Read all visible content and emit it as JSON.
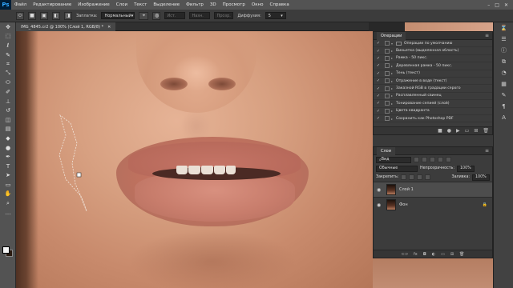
{
  "menubar": {
    "logo": "Ps",
    "items": [
      "Файл",
      "Редактирование",
      "Изображение",
      "Слои",
      "Текст",
      "Выделение",
      "Фильтр",
      "3D",
      "Просмотр",
      "Окно",
      "Справка"
    ],
    "minimize": "–",
    "maximize": "□",
    "close": "✕"
  },
  "options": {
    "mode_label": "Заплатка:",
    "mode_value": "Нормальный",
    "source_label": "Ист.",
    "dest_label": "Назн.",
    "transparent_label": "Прозр.",
    "diffusion_label": "Диффузия:",
    "diffusion_value": "5"
  },
  "document": {
    "tab_title": "IMG_4845.cr2 @ 100% (Слой 1, RGB/8) *",
    "close": "✕"
  },
  "history": {
    "tab": "Операции",
    "group": "Операции по умолчанию",
    "items": [
      "Виньетка (выделенная область)",
      "Рамка - 50 пикс.",
      "Деревянная рамка - 50 пикс.",
      "Тень (текст)",
      "Отражение в воде (текст)",
      "Заказной RGB в градации серого",
      "Расплавленный свинец",
      "Тонирование сепией (слой)",
      "Цвета квадранта",
      "Сохранить как Photoshop PDF"
    ]
  },
  "layers": {
    "tab": "Слои",
    "filter_kind": "Вид",
    "blend_mode": "Обычные",
    "opacity_label": "Непрозрачность:",
    "opacity_value": "100%",
    "lock_label": "Закрепить:",
    "fill_label": "Заливка:",
    "fill_value": "100%",
    "items": [
      {
        "name": "Слой 1",
        "active": true
      },
      {
        "name": "Фон",
        "active": false
      }
    ]
  }
}
